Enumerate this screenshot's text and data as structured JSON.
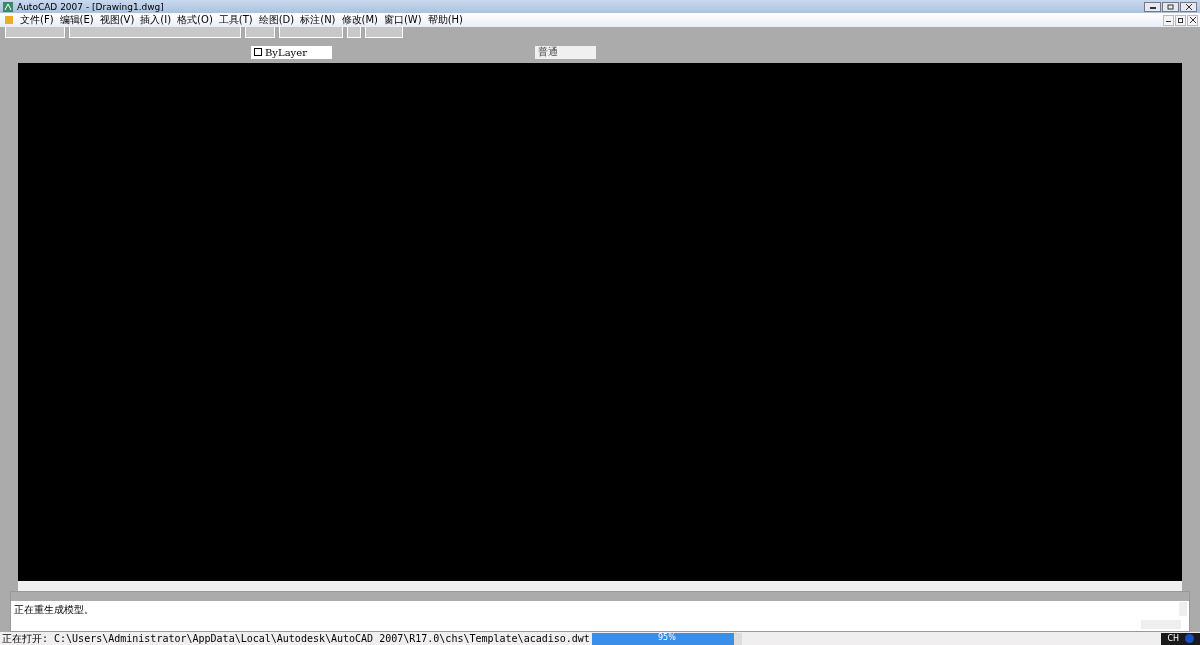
{
  "window": {
    "title": "AutoCAD 2007 - [Drawing1.dwg]"
  },
  "menu": [
    "文件(F)",
    "编辑(E)",
    "视图(V)",
    "插入(I)",
    "格式(O)",
    "工具(T)",
    "绘图(D)",
    "标注(N)",
    "修改(M)",
    "窗口(W)",
    "帮助(H)"
  ],
  "properties": {
    "color_control": "ByLayer",
    "plot_style": "普通"
  },
  "command_line": {
    "history": "正在重生成模型。"
  },
  "status_bar": {
    "text": "正在打开: C:\\Users\\Administrator\\AppData\\Local\\Autodesk\\AutoCAD 2007\\R17.0\\chs\\Template\\acadiso.dwt",
    "progress": {
      "level": 0.95,
      "label": "95%"
    },
    "language": "CH"
  }
}
